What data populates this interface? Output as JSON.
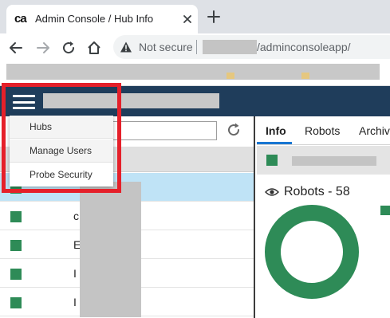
{
  "browser": {
    "tab_favicon": "ca",
    "tab_title": "Admin Console / Hub Info",
    "security_label": "Not secure",
    "url_path": "/adminconsoleapp/"
  },
  "menu": {
    "items": [
      {
        "label": "Hubs"
      },
      {
        "label": "Manage Users"
      },
      {
        "label": "Probe Security"
      }
    ]
  },
  "hub_list": {
    "rows": [
      {
        "name": "",
        "status": "ok",
        "selected": true
      },
      {
        "name": "c",
        "status": "ok",
        "selected": false
      },
      {
        "name": "E                hub",
        "status": "ok",
        "selected": false
      },
      {
        "name": "I",
        "status": "ok",
        "selected": false
      },
      {
        "name": "I",
        "status": "ok",
        "selected": false
      }
    ]
  },
  "detail": {
    "tabs": [
      {
        "label": "Info",
        "active": true
      },
      {
        "label": "Robots",
        "active": false
      },
      {
        "label": "Archive",
        "active": false
      }
    ],
    "robots_label": "Robots - 58",
    "robots_count": 58
  },
  "colors": {
    "app_header": "#1f3d5b",
    "status_ok": "#2e8b57",
    "selected_row": "#bfe3f6",
    "highlight_annotation": "#e5202a",
    "active_tab_underline": "#1976d2"
  },
  "icons": [
    "close-icon",
    "plus-icon",
    "back-arrow-icon",
    "forward-arrow-icon",
    "reload-icon",
    "home-icon",
    "warning-icon",
    "hamburger-icon",
    "refresh-icon",
    "eye-icon"
  ]
}
